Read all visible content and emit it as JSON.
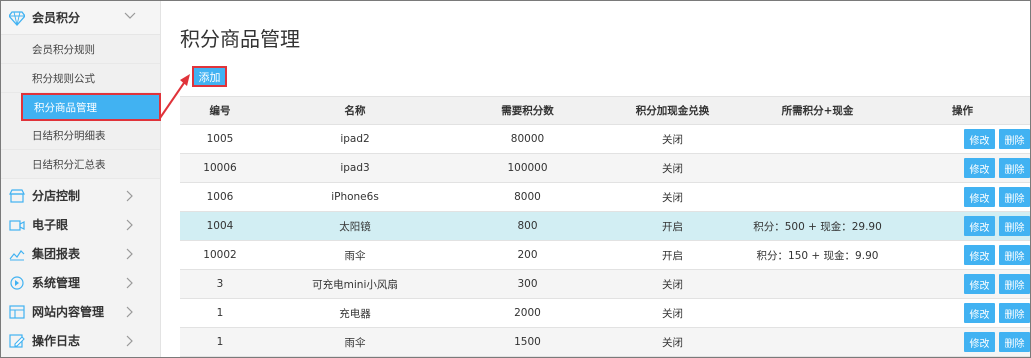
{
  "sidebar": {
    "top_group": {
      "label": "会员积分",
      "icon": "diamond-icon"
    },
    "sub_items": [
      {
        "label": "会员积分规则"
      },
      {
        "label": "积分规则公式"
      },
      {
        "label": "积分商品管理"
      },
      {
        "label": "日结积分明细表"
      },
      {
        "label": "日结积分汇总表"
      }
    ],
    "groups": [
      {
        "label": "分店控制",
        "icon": "store-icon"
      },
      {
        "label": "电子眼",
        "icon": "camera-icon"
      },
      {
        "label": "集团报表",
        "icon": "report-chart-icon"
      },
      {
        "label": "系统管理",
        "icon": "system-settings-icon"
      },
      {
        "label": "网站内容管理",
        "icon": "website-grid-icon"
      },
      {
        "label": "操作日志",
        "icon": "log-edit-icon"
      }
    ]
  },
  "main": {
    "title": "积分商品管理",
    "add_label": "添加",
    "table": {
      "headers": [
        "编号",
        "名称",
        "需要积分数",
        "积分加现金兑换",
        "所需积分+现金",
        "操作"
      ],
      "edit_label": "修改",
      "delete_label": "删除",
      "rows": [
        {
          "id": "1005",
          "name": "ipad2",
          "points": "80000",
          "cash_exchange": "关闭",
          "combo": ""
        },
        {
          "id": "10006",
          "name": "ipad3",
          "points": "100000",
          "cash_exchange": "关闭",
          "combo": ""
        },
        {
          "id": "1006",
          "name": "iPhone6s",
          "points": "8000",
          "cash_exchange": "关闭",
          "combo": ""
        },
        {
          "id": "1004",
          "name": "太阳镜",
          "points": "800",
          "cash_exchange": "开启",
          "combo": "积分：500 + 现金：29.90"
        },
        {
          "id": "10002",
          "name": "雨伞",
          "points": "200",
          "cash_exchange": "开启",
          "combo": "积分：150 + 现金：9.90"
        },
        {
          "id": "3",
          "name": "可充电mini小风扇",
          "points": "300",
          "cash_exchange": "关闭",
          "combo": ""
        },
        {
          "id": "1",
          "name": "充电器",
          "points": "2000",
          "cash_exchange": "关闭",
          "combo": ""
        },
        {
          "id": "1",
          "name": "雨伞",
          "points": "1500",
          "cash_exchange": "关闭",
          "combo": ""
        }
      ]
    }
  },
  "colors": {
    "accent": "#41b2f2",
    "highlight_row": "#d2eef3",
    "annotation_red": "#e0333a"
  }
}
